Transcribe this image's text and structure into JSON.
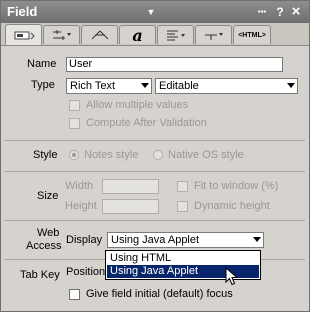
{
  "window": {
    "title": "Field"
  },
  "titlebar": {
    "more_label": "▪▪▪",
    "help_label": "?",
    "close_label": "×"
  },
  "tabs": [
    {
      "name": "basics",
      "label": "",
      "icon": "field-basics-icon",
      "active": true
    },
    {
      "name": "control",
      "label": "",
      "icon": "control-options-icon"
    },
    {
      "name": "advanced",
      "label": "",
      "icon": "advanced-icon"
    },
    {
      "name": "font",
      "label": "a",
      "icon": "font-icon"
    },
    {
      "name": "paragraph",
      "label": "",
      "icon": "paragraph-alignment-icon"
    },
    {
      "name": "hide-when",
      "label": "",
      "icon": "hide-when-icon"
    },
    {
      "name": "html",
      "label": "<HTML>",
      "icon": "html-icon"
    }
  ],
  "basics": {
    "name_label": "Name",
    "name_value": "User",
    "type_label": "Type",
    "type_value": "Rich Text",
    "type_mode_value": "Editable",
    "allow_multiple_label": "Allow multiple values",
    "compute_after_label": "Compute After Validation"
  },
  "style": {
    "section_label": "Style",
    "notes_style_label": "Notes style",
    "native_os_label": "Native OS style"
  },
  "size": {
    "section_label": "Size",
    "width_label": "Width",
    "height_label": "Height",
    "width_value": "",
    "height_value": "",
    "fit_window_label": "Fit to window (%)",
    "dynamic_height_label": "Dynamic height"
  },
  "web_access": {
    "section_label_1": "Web",
    "section_label_2": "Access",
    "display_label": "Display",
    "display_value": "Using Java Applet",
    "options": [
      "Using HTML",
      "Using Java Applet"
    ]
  },
  "tab_key": {
    "section_label": "Tab Key",
    "position_label": "Position",
    "give_focus_label": "Give field initial (default) focus"
  }
}
